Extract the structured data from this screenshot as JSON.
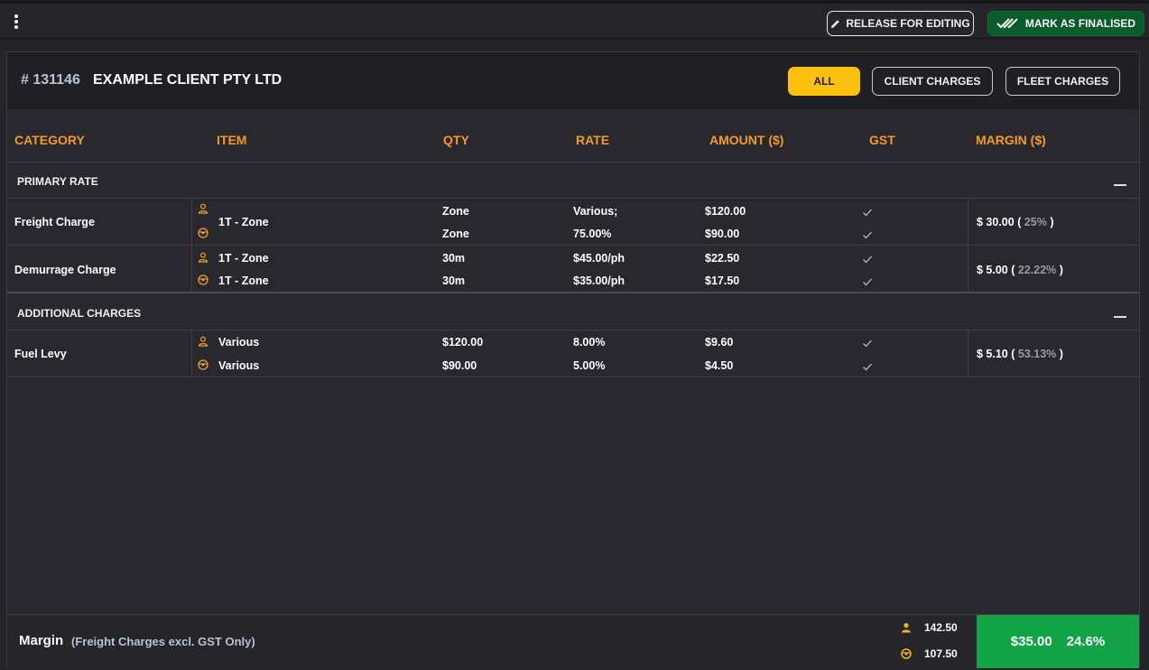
{
  "toolbar": {
    "release_label": "RELEASE FOR EDITING",
    "finalise_label": "MARK AS FINALISED"
  },
  "header": {
    "job_number": "# 131146",
    "client_name": "EXAMPLE CLIENT PTY LTD",
    "filters": [
      "ALL",
      "CLIENT CHARGES",
      "FLEET CHARGES"
    ],
    "active_filter": "ALL"
  },
  "columns": {
    "category": "CATEGORY",
    "item": "ITEM",
    "qty": "QTY",
    "rate": "RATE",
    "amount": "AMOUNT ($)",
    "gst": "GST",
    "margin": "MARGIN ($)"
  },
  "sections": [
    {
      "title": "PRIMARY RATE",
      "rows": [
        {
          "category": "Freight Charge",
          "lines": [
            {
              "icon": "client-user-icon",
              "item": "1T - Zone",
              "qty": "Zone",
              "rate": "Various;",
              "amount": "$120.00",
              "gst": true
            },
            {
              "icon": "fleet-steering-wheel-icon",
              "item": "",
              "qty": "Zone",
              "rate": "75.00%",
              "amount": "$90.00",
              "gst": true
            }
          ],
          "margin_amount": "$ 30.00",
          "margin_percent": "25%"
        },
        {
          "category": "Demurrage Charge",
          "lines": [
            {
              "icon": "client-user-icon",
              "item": "1T - Zone",
              "qty": "30m",
              "rate": "$45.00/ph",
              "amount": "$22.50",
              "gst": true
            },
            {
              "icon": "fleet-steering-wheel-icon",
              "item": "1T - Zone",
              "qty": "30m",
              "rate": "$35.00/ph",
              "amount": "$17.50",
              "gst": true
            }
          ],
          "margin_amount": "$ 5.00",
          "margin_percent": "22.22%"
        }
      ]
    },
    {
      "title": "ADDITIONAL CHARGES",
      "rows": [
        {
          "category": "Fuel Levy",
          "lines": [
            {
              "icon": "client-user-icon",
              "item": "Various",
              "qty": "$120.00",
              "rate": "8.00%",
              "amount": "$9.60",
              "gst": true
            },
            {
              "icon": "fleet-steering-wheel-icon",
              "item": "Various",
              "qty": "$90.00",
              "rate": "5.00%",
              "amount": "$4.50",
              "gst": true
            }
          ],
          "margin_amount": "$ 5.10",
          "margin_percent": "53.13%"
        }
      ]
    }
  ],
  "footer": {
    "label": "Margin",
    "sublabel": "(Freight Charges excl. GST Only)",
    "client_total": "142.50",
    "fleet_total": "107.50",
    "margin_total": "$35.00",
    "margin_percent": "24.6%"
  },
  "colors": {
    "accent_orange": "#f39c24",
    "active_filter": "#fcc10e",
    "finalise_green": "#0c5b2c",
    "total_green": "#12a447",
    "icon_orange": "#f0a030",
    "icon_yellow": "#f3b617"
  }
}
